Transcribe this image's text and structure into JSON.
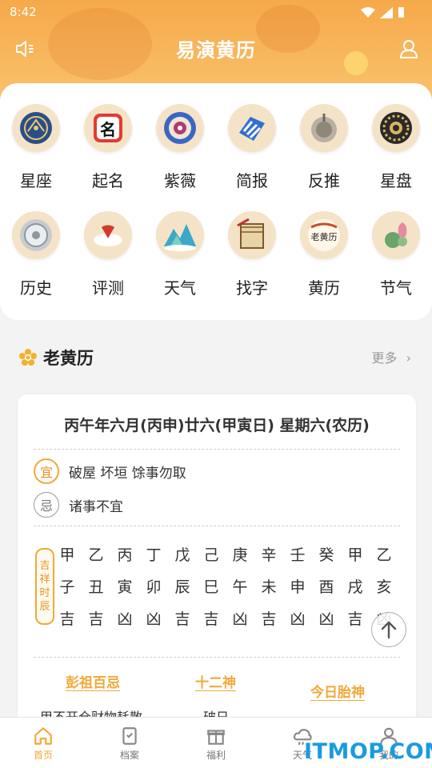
{
  "status": {
    "time": "8:42"
  },
  "header": {
    "title": "易演黄历"
  },
  "features": {
    "row1": [
      {
        "label": "星座",
        "icon": "constellation-icon"
      },
      {
        "label": "起名",
        "icon": "naming-icon"
      },
      {
        "label": "紫薇",
        "icon": "ziwei-icon"
      },
      {
        "label": "简报",
        "icon": "briefing-icon"
      },
      {
        "label": "反推",
        "icon": "reverse-icon"
      },
      {
        "label": "星盘",
        "icon": "astrolabe-icon"
      }
    ],
    "row2": [
      {
        "label": "历史",
        "icon": "compass-icon"
      },
      {
        "label": "评测",
        "icon": "fan-icon"
      },
      {
        "label": "天气",
        "icon": "mountain-icon"
      },
      {
        "label": "找字",
        "icon": "book-icon"
      },
      {
        "label": "黄历",
        "icon": "almanac-icon"
      },
      {
        "label": "节气",
        "icon": "lotus-icon"
      }
    ]
  },
  "section": {
    "title": "老黄历",
    "more": "更多"
  },
  "calendar": {
    "date": "丙午年六月(丙申)廿六(甲寅日) 星期六(农历)",
    "yi_badge": "宜",
    "yi_text": "破屋 坏垣 馀事勿取",
    "ji_badge": "忌",
    "ji_text": "诸事不宜",
    "shichen_tag": [
      "吉",
      "祥",
      "时",
      "辰"
    ],
    "stems": [
      "甲",
      "乙",
      "丙",
      "丁",
      "戊",
      "己",
      "庚",
      "辛",
      "壬",
      "癸",
      "甲",
      "乙"
    ],
    "branches": [
      "子",
      "丑",
      "寅",
      "卯",
      "辰",
      "巳",
      "午",
      "未",
      "申",
      "酉",
      "戌",
      "亥"
    ],
    "luck": [
      "吉",
      "吉",
      "凶",
      "凶",
      "吉",
      "吉",
      "凶",
      "吉",
      "凶",
      "凶",
      "吉",
      "凶"
    ],
    "pengzu_title": "彭祖百忌",
    "shier_title": "十二神",
    "taishen_title": "今日胎神",
    "pengzu_text": "甲不开仓财物耗散",
    "shier_text": "破日"
  },
  "tabs": [
    {
      "label": "首页",
      "icon": "home-icon"
    },
    {
      "label": "档案",
      "icon": "archive-icon"
    },
    {
      "label": "福利",
      "icon": "gift-icon"
    },
    {
      "label": "天气",
      "icon": "weather-icon"
    },
    {
      "label": "我的",
      "icon": "user-icon"
    }
  ],
  "watermark": "ITMOP.COM",
  "colors": {
    "accent": "#f0a93a",
    "header": "#f6a94a"
  }
}
